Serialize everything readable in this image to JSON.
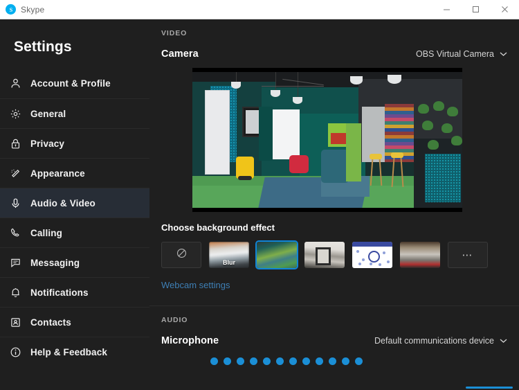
{
  "window": {
    "title": "Skype",
    "logo_icon": "skype-logo-icon",
    "controls": [
      {
        "name": "minimize",
        "icon": "minimize-icon"
      },
      {
        "name": "maximize",
        "icon": "maximize-icon"
      },
      {
        "name": "close",
        "icon": "close-icon"
      }
    ]
  },
  "sidebar": {
    "title": "Settings",
    "items": [
      {
        "label": "Account & Profile",
        "icon": "person-icon",
        "active": false
      },
      {
        "label": "General",
        "icon": "gear-icon",
        "active": false
      },
      {
        "label": "Privacy",
        "icon": "lock-icon",
        "active": false
      },
      {
        "label": "Appearance",
        "icon": "magic-wand-icon",
        "active": false
      },
      {
        "label": "Audio & Video",
        "icon": "microphone-icon",
        "active": true
      },
      {
        "label": "Calling",
        "icon": "phone-icon",
        "active": false
      },
      {
        "label": "Messaging",
        "icon": "chat-bubble-icon",
        "active": false
      },
      {
        "label": "Notifications",
        "icon": "bell-icon",
        "active": false
      },
      {
        "label": "Contacts",
        "icon": "contact-card-icon",
        "active": false
      },
      {
        "label": "Help & Feedback",
        "icon": "info-circle-icon",
        "active": false
      }
    ]
  },
  "video": {
    "section_label": "VIDEO",
    "camera_row_title": "Camera",
    "camera_selected": "OBS Virtual Camera",
    "camera_chevron_icon": "chevron-down-icon",
    "preview_alt": "camera-preview-office-interior",
    "background_effect_title": "Choose background effect",
    "effects": [
      {
        "name": "none",
        "label": "",
        "icon": "no-effect-icon",
        "selected": false
      },
      {
        "name": "blur",
        "label": "Blur",
        "icon": "",
        "selected": false
      },
      {
        "name": "office",
        "label": "",
        "icon": "",
        "selected": true
      },
      {
        "name": "white-room",
        "label": "",
        "icon": "",
        "selected": false
      },
      {
        "name": "snow",
        "label": "",
        "icon": "",
        "selected": false
      },
      {
        "name": "cafe",
        "label": "",
        "icon": "",
        "selected": false
      },
      {
        "name": "more",
        "label": "",
        "icon": "more-dots-icon",
        "selected": false
      }
    ],
    "webcam_settings_link": "Webcam settings"
  },
  "audio": {
    "section_label": "AUDIO",
    "microphone_row_title": "Microphone",
    "microphone_selected": "Default communications device",
    "microphone_chevron_icon": "chevron-down-icon",
    "level_dots_total": 12,
    "level_dots_lit": 12
  },
  "colors": {
    "accent": "#1b8fd6",
    "selection_border": "#0f84d8",
    "link": "#3e7fb5",
    "sidebar_bg": "#1f1f1f",
    "active_row_bg": "#272d36",
    "titlebar_bg": "#ffffff"
  }
}
